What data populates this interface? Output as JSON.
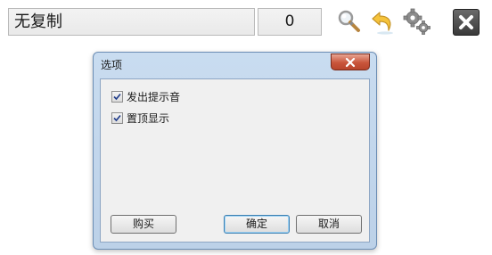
{
  "toolbar": {
    "text_value": "无复制",
    "count_value": "0",
    "icons": [
      "search-icon",
      "undo-icon",
      "gear-icon",
      "close-icon"
    ]
  },
  "dialog": {
    "title": "选项",
    "options": [
      {
        "label": "发出提示音",
        "checked": true
      },
      {
        "label": "置顶显示",
        "checked": true
      }
    ],
    "buttons": {
      "buy": "购买",
      "ok": "确定",
      "cancel": "取消"
    }
  },
  "colors": {
    "dialog_frame": "#bcd1e8",
    "close_red": "#c9553b",
    "ok_focus": "#3c7fb1"
  }
}
